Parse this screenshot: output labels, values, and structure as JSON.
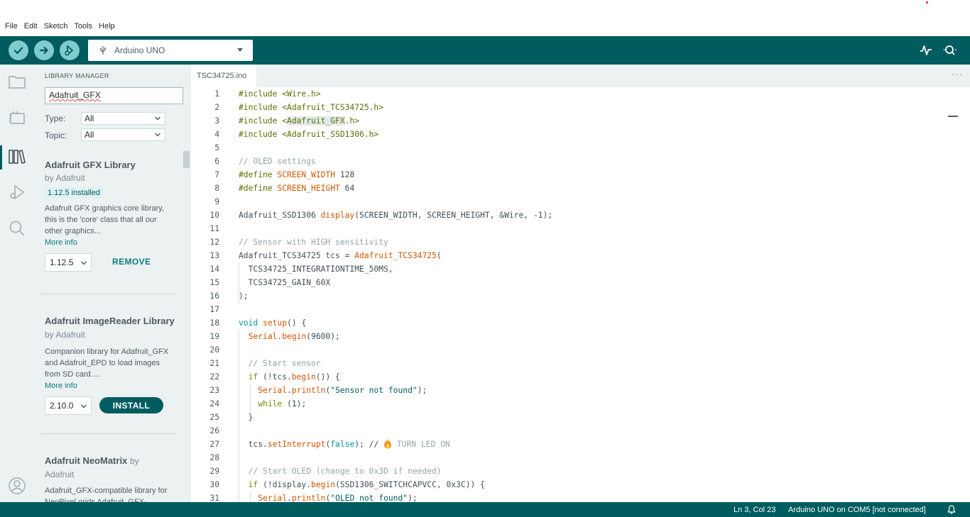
{
  "menu": [
    "File",
    "Edit",
    "Sketch",
    "Tools",
    "Help"
  ],
  "toolbar": {
    "board": "Arduino UNO",
    "verify_icon": "check-icon",
    "upload_icon": "arrow-right-icon",
    "debug_icon": "debug-icon",
    "plotter_icon": "serial-plotter-icon",
    "monitor_icon": "serial-monitor-icon"
  },
  "rail": [
    "folder-icon",
    "boards-icon",
    "library-icon",
    "debug-icon",
    "search-icon",
    "account-icon"
  ],
  "library_manager": {
    "title": "LIBRARY MANAGER",
    "search_value": "Adafruit_GFX",
    "type_label": "Type:",
    "type_value": "All",
    "topic_label": "Topic:",
    "topic_value": "All",
    "items": [
      {
        "name": "Adafruit GFX Library",
        "by": "by Adafruit",
        "badge": "1.12.5 installed",
        "desc": "Adafruit GFX graphics core library, this is the 'core' class that all our other graphics...",
        "more": "More info",
        "version": "1.12.5",
        "action": "REMOVE"
      },
      {
        "name": "Adafruit ImageReader Library",
        "by": "by Adafruit",
        "desc": "Companion library for Adafruit_GFX and Adafruit_EPD to load images from SD card....",
        "more": "More info",
        "version": "2.10.0",
        "action": "INSTALL"
      },
      {
        "name": "Adafruit NeoMatrix",
        "by": "by",
        "author": "Adafruit",
        "desc": "Adafruit_GFX-compatible library for NeoPixel grids Adafruit_GFX-"
      }
    ]
  },
  "editor": {
    "tab": "TSC34725.ino",
    "more": "···",
    "line_numbers": [
      "1",
      "2",
      "3",
      "4",
      "5",
      "6",
      "7",
      "8",
      "9",
      "10",
      "11",
      "12",
      "13",
      "14",
      "15",
      "16",
      "17",
      "18",
      "19",
      "20",
      "21",
      "22",
      "23",
      "24",
      "25",
      "26",
      "27",
      "28",
      "29",
      "30",
      "31"
    ],
    "code": {
      "l1a": "#include <Wire.h>",
      "l2a": "#include <Adafruit_TCS34725.h>",
      "l3a": "#include <",
      "l3b": "Adafruit_GFX",
      "l3c": ".h>",
      "l4a": "#include <Adafruit_SSD1306.h>",
      "l6a": "// OLED settings",
      "l7a": "#define ",
      "l7b": "SCREEN_WIDTH",
      "l7c": " 128",
      "l8a": "#define ",
      "l8b": "SCREEN_HEIGHT",
      "l8c": " 64",
      "l10a": "Adafruit_SSD1306 ",
      "l10b": "display",
      "l10c": "(SCREEN_WIDTH, SCREEN_HEIGHT, &Wire, -1);",
      "l12a": "// Sensor with HIGH sensitivity",
      "l13a": "Adafruit_TCS34725 tcs = ",
      "l13b": "Adafruit_TCS34725",
      "l13c": "(",
      "l14a": "  TCS34725_INTEGRATIONTIME_50MS,",
      "l15a": "  TCS34725_GAIN_60X",
      "l16a": ");",
      "l18a": "void",
      "l18b": " ",
      "l18c": "setup",
      "l18d": "() {",
      "l19a": "  ",
      "l19b": "Serial",
      "l19c": ".",
      "l19d": "begin",
      "l19e": "(9600);",
      "l21a": "  // Start sensor",
      "l22a": "  ",
      "l22b": "if",
      "l22c": " (!tcs.",
      "l22d": "begin",
      "l22e": "()) {",
      "l23a": "    ",
      "l23b": "Serial",
      "l23c": ".",
      "l23d": "println",
      "l23e": "(",
      "l23f": "\"Sensor not found\"",
      "l23g": ");",
      "l24a": "    ",
      "l24b": "while",
      "l24c": " (1);",
      "l25a": "  }",
      "l27a": "  tcs.",
      "l27b": "setInterrupt",
      "l27c": "(",
      "l27d": "false",
      "l27e": "); // ",
      "l27f": " TURN LED ON",
      "l29a": "  // Start OLED (change to 0x3D if needed)",
      "l30a": "  ",
      "l30b": "if",
      "l30c": " (!display.",
      "l30d": "begin",
      "l30e": "(SSD1306_SWITCHCAPVCC, 0x3C)) {",
      "l31a": "    ",
      "l31b": "Serial",
      "l31c": ".",
      "l31d": "println",
      "l31e": "(",
      "l31f": "\"OLED not found\"",
      "l31g": ");"
    }
  },
  "status": {
    "position": "Ln 3, Col 23",
    "board_port": "Arduino UNO on COM5 [not connected]",
    "bell_icon": "bell-icon"
  }
}
